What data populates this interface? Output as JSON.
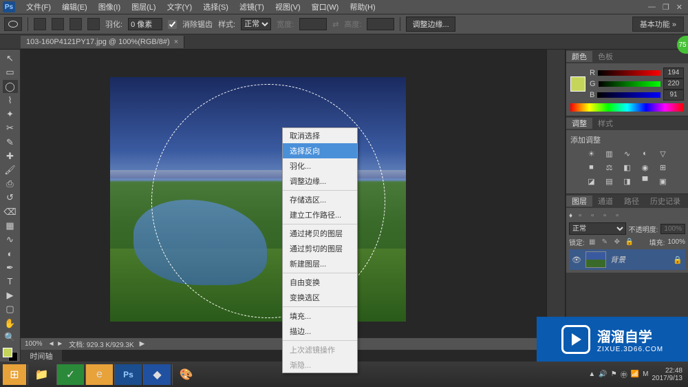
{
  "app": {
    "logo": "Ps"
  },
  "menubar": [
    "文件(F)",
    "编辑(E)",
    "图像(I)",
    "图层(L)",
    "文字(Y)",
    "选择(S)",
    "滤镜(T)",
    "视图(V)",
    "窗口(W)",
    "帮助(H)"
  ],
  "window_controls": {
    "min": "—",
    "max": "❐",
    "close": "✕"
  },
  "options": {
    "feather_label": "羽化:",
    "feather_value": "0 像素",
    "antialias": "消除锯齿",
    "style_label": "样式:",
    "style_value": "正常",
    "width_label": "宽度:",
    "height_label": "高度:",
    "refine": "调整边缘...",
    "workspace": "基本功能"
  },
  "tab": {
    "title": "103-160P4121PY17.jpg @ 100%(RGB/8#)",
    "close": "×"
  },
  "tools": [
    {
      "name": "move-tool",
      "glyph": "↖"
    },
    {
      "name": "rect-marquee-tool",
      "glyph": "▭"
    },
    {
      "name": "ellipse-marquee-tool",
      "glyph": "◯",
      "active": true
    },
    {
      "name": "lasso-tool",
      "glyph": "⌇"
    },
    {
      "name": "quick-select-tool",
      "glyph": "✦"
    },
    {
      "name": "crop-tool",
      "glyph": "✂"
    },
    {
      "name": "eyedropper-tool",
      "glyph": "✎"
    },
    {
      "name": "healing-tool",
      "glyph": "✚"
    },
    {
      "name": "brush-tool",
      "glyph": "🖌"
    },
    {
      "name": "stamp-tool",
      "glyph": "⎙"
    },
    {
      "name": "history-brush-tool",
      "glyph": "↺"
    },
    {
      "name": "eraser-tool",
      "glyph": "⌫"
    },
    {
      "name": "gradient-tool",
      "glyph": "▦"
    },
    {
      "name": "blur-tool",
      "glyph": "∿"
    },
    {
      "name": "dodge-tool",
      "glyph": "◐"
    },
    {
      "name": "pen-tool",
      "glyph": "✒"
    },
    {
      "name": "type-tool",
      "glyph": "T"
    },
    {
      "name": "path-select-tool",
      "glyph": "▶"
    },
    {
      "name": "shape-tool",
      "glyph": "▢"
    },
    {
      "name": "hand-tool",
      "glyph": "✋"
    },
    {
      "name": "zoom-tool",
      "glyph": "🔍"
    }
  ],
  "colors": {
    "fg": "#c5d55b",
    "bg": "#000000"
  },
  "context_menu": [
    {
      "label": "取消选择",
      "type": "item"
    },
    {
      "label": "选择反向",
      "type": "item",
      "highlighted": true
    },
    {
      "label": "羽化...",
      "type": "item"
    },
    {
      "label": "调整边缘...",
      "type": "item"
    },
    {
      "type": "sep"
    },
    {
      "label": "存储选区...",
      "type": "item"
    },
    {
      "label": "建立工作路径...",
      "type": "item"
    },
    {
      "type": "sep"
    },
    {
      "label": "通过拷贝的图层",
      "type": "item"
    },
    {
      "label": "通过剪切的图层",
      "type": "item"
    },
    {
      "label": "新建图层...",
      "type": "item"
    },
    {
      "type": "sep"
    },
    {
      "label": "自由变换",
      "type": "item"
    },
    {
      "label": "变换选区",
      "type": "item"
    },
    {
      "type": "sep"
    },
    {
      "label": "填充...",
      "type": "item"
    },
    {
      "label": "描边...",
      "type": "item"
    },
    {
      "type": "sep"
    },
    {
      "label": "上次滤镜操作",
      "type": "item",
      "disabled": true
    },
    {
      "label": "渐隐...",
      "type": "item",
      "disabled": true
    }
  ],
  "panels": {
    "color": {
      "tabs": [
        "颜色",
        "色板"
      ],
      "channels": [
        {
          "label": "R",
          "value": "194"
        },
        {
          "label": "G",
          "value": "220"
        },
        {
          "label": "B",
          "value": "91"
        }
      ]
    },
    "adjustments": {
      "tabs": [
        "调整",
        "样式"
      ],
      "title": "添加调整"
    },
    "layers": {
      "tabs": [
        "图层",
        "通道",
        "路径",
        "历史记录"
      ],
      "blend_mode": "正常",
      "opacity_label": "不透明度:",
      "opacity_value": "100%",
      "lock_label": "锁定:",
      "fill_label": "填充:",
      "fill_value": "100%",
      "layer_name": "背景"
    }
  },
  "status": {
    "zoom": "100%",
    "doc": "文档: 929.3 K/929.3K"
  },
  "timeline_tab": "时间轴",
  "watermark": {
    "text": "溜溜自学",
    "sub": "ZIXUE.3D66.COM"
  },
  "badge": "75",
  "taskbar": {
    "clock_time": "22:48",
    "clock_date": "2017/9/13"
  }
}
